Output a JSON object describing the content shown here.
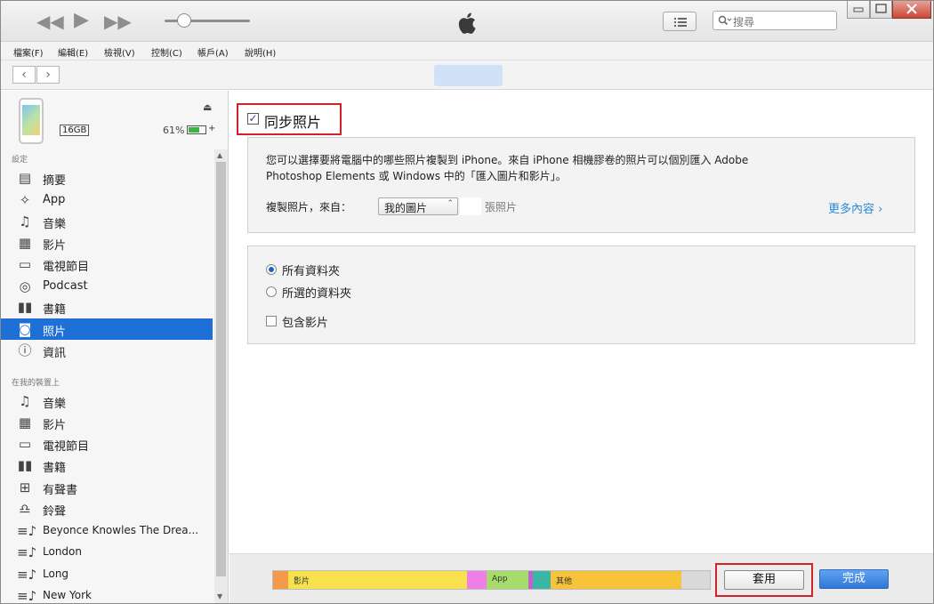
{
  "window": {
    "search_placeholder": "搜尋"
  },
  "menu": [
    "檔案(F)",
    "編輯(E)",
    "檢視(V)",
    "控制(C)",
    "帳戶(A)",
    "說明(H)"
  ],
  "device": {
    "capacity": "16GB",
    "battery_percent": "61%"
  },
  "sidebar": {
    "settings_label": "設定",
    "settings_items": [
      {
        "label": "摘要",
        "icon": "summary-icon"
      },
      {
        "label": "App",
        "icon": "app-icon"
      },
      {
        "label": "音樂",
        "icon": "music-icon"
      },
      {
        "label": "影片",
        "icon": "film-icon"
      },
      {
        "label": "電視節目",
        "icon": "tv-icon"
      },
      {
        "label": "Podcast",
        "icon": "podcast-icon"
      },
      {
        "label": "書籍",
        "icon": "book-icon"
      },
      {
        "label": "照片",
        "icon": "camera-icon",
        "active": true
      },
      {
        "label": "資訊",
        "icon": "info-icon"
      }
    ],
    "ondevice_label": "在我的裝置上",
    "ondevice_items": [
      {
        "label": "音樂",
        "icon": "music-icon"
      },
      {
        "label": "影片",
        "icon": "film-icon"
      },
      {
        "label": "電視節目",
        "icon": "tv-icon"
      },
      {
        "label": "書籍",
        "icon": "book-icon"
      },
      {
        "label": "有聲書",
        "icon": "audiobook-icon"
      },
      {
        "label": "鈴聲",
        "icon": "bell-icon"
      },
      {
        "label": "Beyonce Knowles The Drea...",
        "icon": "playlist-icon"
      },
      {
        "label": "London",
        "icon": "playlist-icon"
      },
      {
        "label": "Long",
        "icon": "playlist-icon"
      },
      {
        "label": "New York",
        "icon": "playlist-icon"
      }
    ]
  },
  "main": {
    "sync_label": "同步照片",
    "sync_checked": true,
    "description_line1": "您可以選擇要將電腦中的哪些照片複製到 iPhone。來自 iPhone 相機膠卷的照片可以個別匯入 Adobe",
    "description_line2": "Photoshop Elements 或 Windows 中的「匯入圖片和影片」。",
    "copy_from_label": "複製照片，來自：",
    "copy_from_value": "我的圖片",
    "count_suffix": "張照片",
    "more_link": "更多內容",
    "options": {
      "all_folders": "所有資料夾",
      "selected_folders": "所選的資料夾",
      "include_videos": "包含影片",
      "selected_option": "all_folders"
    }
  },
  "capacity_bar": {
    "segments": [
      {
        "label": "",
        "color": "#f39a4b",
        "fraction": 0.035
      },
      {
        "label": "影片",
        "color": "#f7e14e",
        "fraction": 0.41
      },
      {
        "label": "",
        "color": "#ef7ee8",
        "fraction": 0.045
      },
      {
        "label": "App",
        "color": "#a6dd6a",
        "fraction": 0.095
      },
      {
        "label": "",
        "color": "#c65ed0",
        "fraction": 0.01
      },
      {
        "label": "",
        "color": "#3ab7a4",
        "fraction": 0.04
      },
      {
        "label": "其他",
        "color": "#f7c33a",
        "fraction": 0.3
      },
      {
        "label": "",
        "color": "#d9d9d9",
        "fraction": 0.065
      }
    ]
  },
  "buttons": {
    "apply": "套用",
    "done": "完成"
  }
}
